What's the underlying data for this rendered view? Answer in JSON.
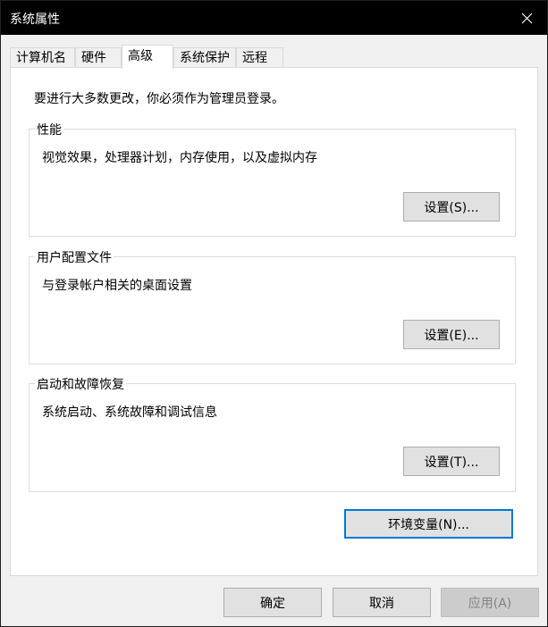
{
  "window": {
    "title": "系统属性",
    "close_glyph": "×"
  },
  "tabs": [
    {
      "label": "计算机名",
      "active": false
    },
    {
      "label": "硬件",
      "active": false
    },
    {
      "label": "高级",
      "active": true
    },
    {
      "label": "系统保护",
      "active": false
    },
    {
      "label": "远程",
      "active": false
    }
  ],
  "panel": {
    "notice": "要进行大多数更改，你必须作为管理员登录。",
    "groups": [
      {
        "title": "性能",
        "description": "视觉效果，处理器计划，内存使用，以及虚拟内存",
        "button": "设置(S)..."
      },
      {
        "title": "用户配置文件",
        "description": "与登录帐户相关的桌面设置",
        "button": "设置(E)..."
      },
      {
        "title": "启动和故障恢复",
        "description": "系统启动、系统故障和调试信息",
        "button": "设置(T)..."
      }
    ],
    "env_button": "环境变量(N)..."
  },
  "footer": {
    "ok": "确定",
    "cancel": "取消",
    "apply": "应用(A)"
  },
  "colors": {
    "titlebar": "#000000",
    "focus_border": "#0078d7",
    "button_face": "#e1e1e1",
    "disabled_face": "#cccccc",
    "disabled_text": "#838383"
  },
  "icons": {
    "close": "close-icon"
  }
}
